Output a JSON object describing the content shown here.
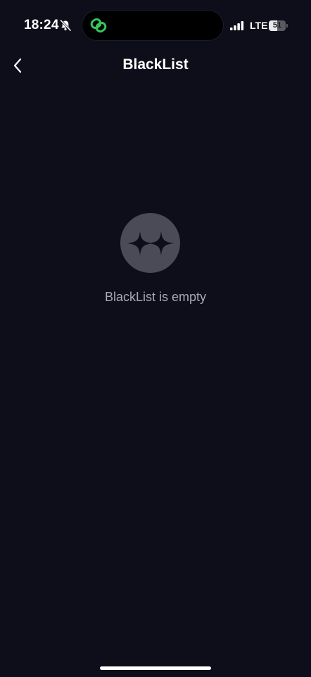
{
  "status_bar": {
    "time": "18:24",
    "network": "LTE",
    "battery_level": "51",
    "battery_fraction": 0.51,
    "icons": [
      "bell-slash-icon",
      "link-icon",
      "signal-icon",
      "battery-icon"
    ],
    "accent_color": "#34c759"
  },
  "header": {
    "title": "BlackList",
    "back_icon": "chevron-left-icon"
  },
  "empty_state": {
    "icon": "sparkles-icon",
    "message": "BlackList is empty"
  },
  "colors": {
    "background": "#0e0e1b",
    "badge": "#4b4a57",
    "text_primary": "#ffffff",
    "text_secondary": "#a9a9b4"
  }
}
